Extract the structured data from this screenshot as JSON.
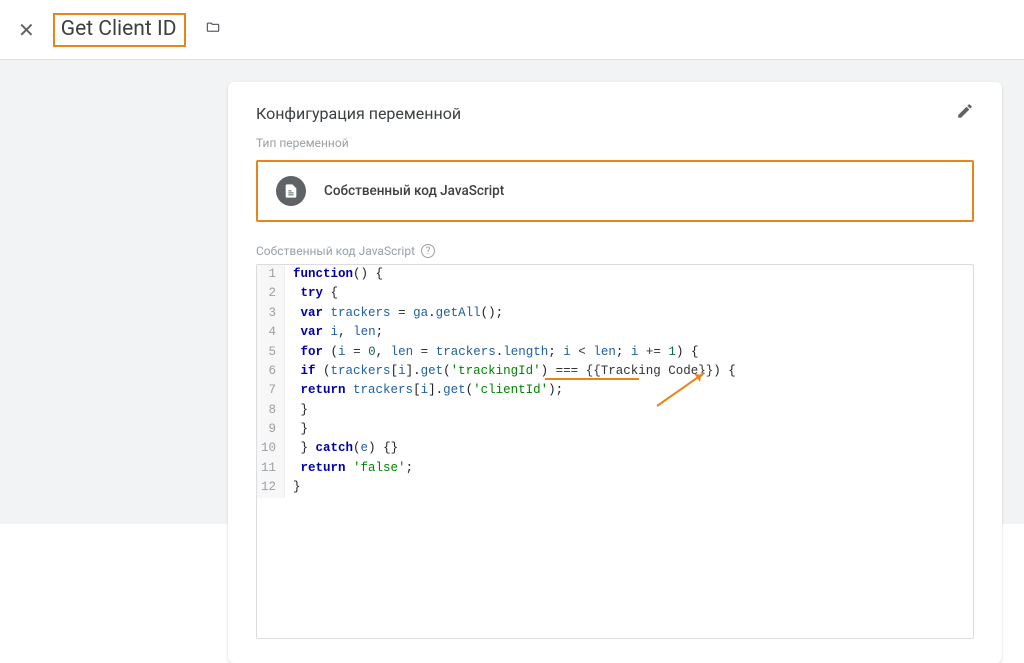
{
  "topbar": {
    "title": "Get Client ID"
  },
  "card": {
    "title": "Конфигурация переменной",
    "type_label": "Тип переменной",
    "variable_type": "Собственный код JavaScript",
    "code_section_label": "Собственный код JavaScript"
  },
  "code_lines": [
    "function() {",
    " try {",
    " var trackers = ga.getAll();",
    " var i, len;",
    " for (i = 0, len = trackers.length; i < len; i += 1) {",
    " if (trackers[i].get('trackingId') === {{Tracking Code}}) {",
    " return trackers[i].get('clientId');",
    " }",
    " }",
    " } catch(e) {}",
    " return 'false';",
    "}"
  ]
}
